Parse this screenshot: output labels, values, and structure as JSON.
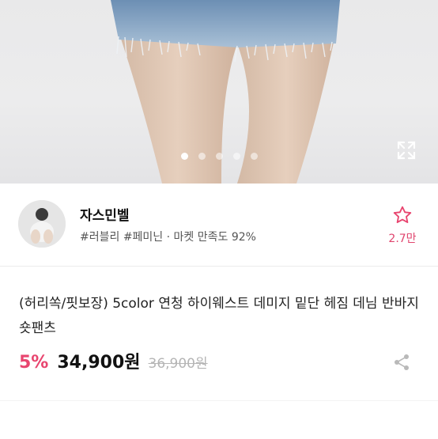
{
  "hero": {
    "image_alt": "product photo",
    "page_dots": 5,
    "active_dot": 0
  },
  "seller": {
    "name": "자스민벨",
    "tags": "#러블리 #페미닌 · 마켓 만족도 92%",
    "favorite_count": "2.7만"
  },
  "product": {
    "title": "(허리쏙/핏보장) 5color 연청 하이웨스트 데미지 밑단 헤짐 데님 반바지 숏팬츠",
    "discount": "5%",
    "price": "34,900원",
    "original_price": "36,900원"
  },
  "colors": {
    "accent": "#e8456f",
    "text": "#222222",
    "muted": "#b5b5b5"
  },
  "icons": {
    "expand": "expand-icon",
    "favorite": "star-icon",
    "share": "share-icon"
  }
}
